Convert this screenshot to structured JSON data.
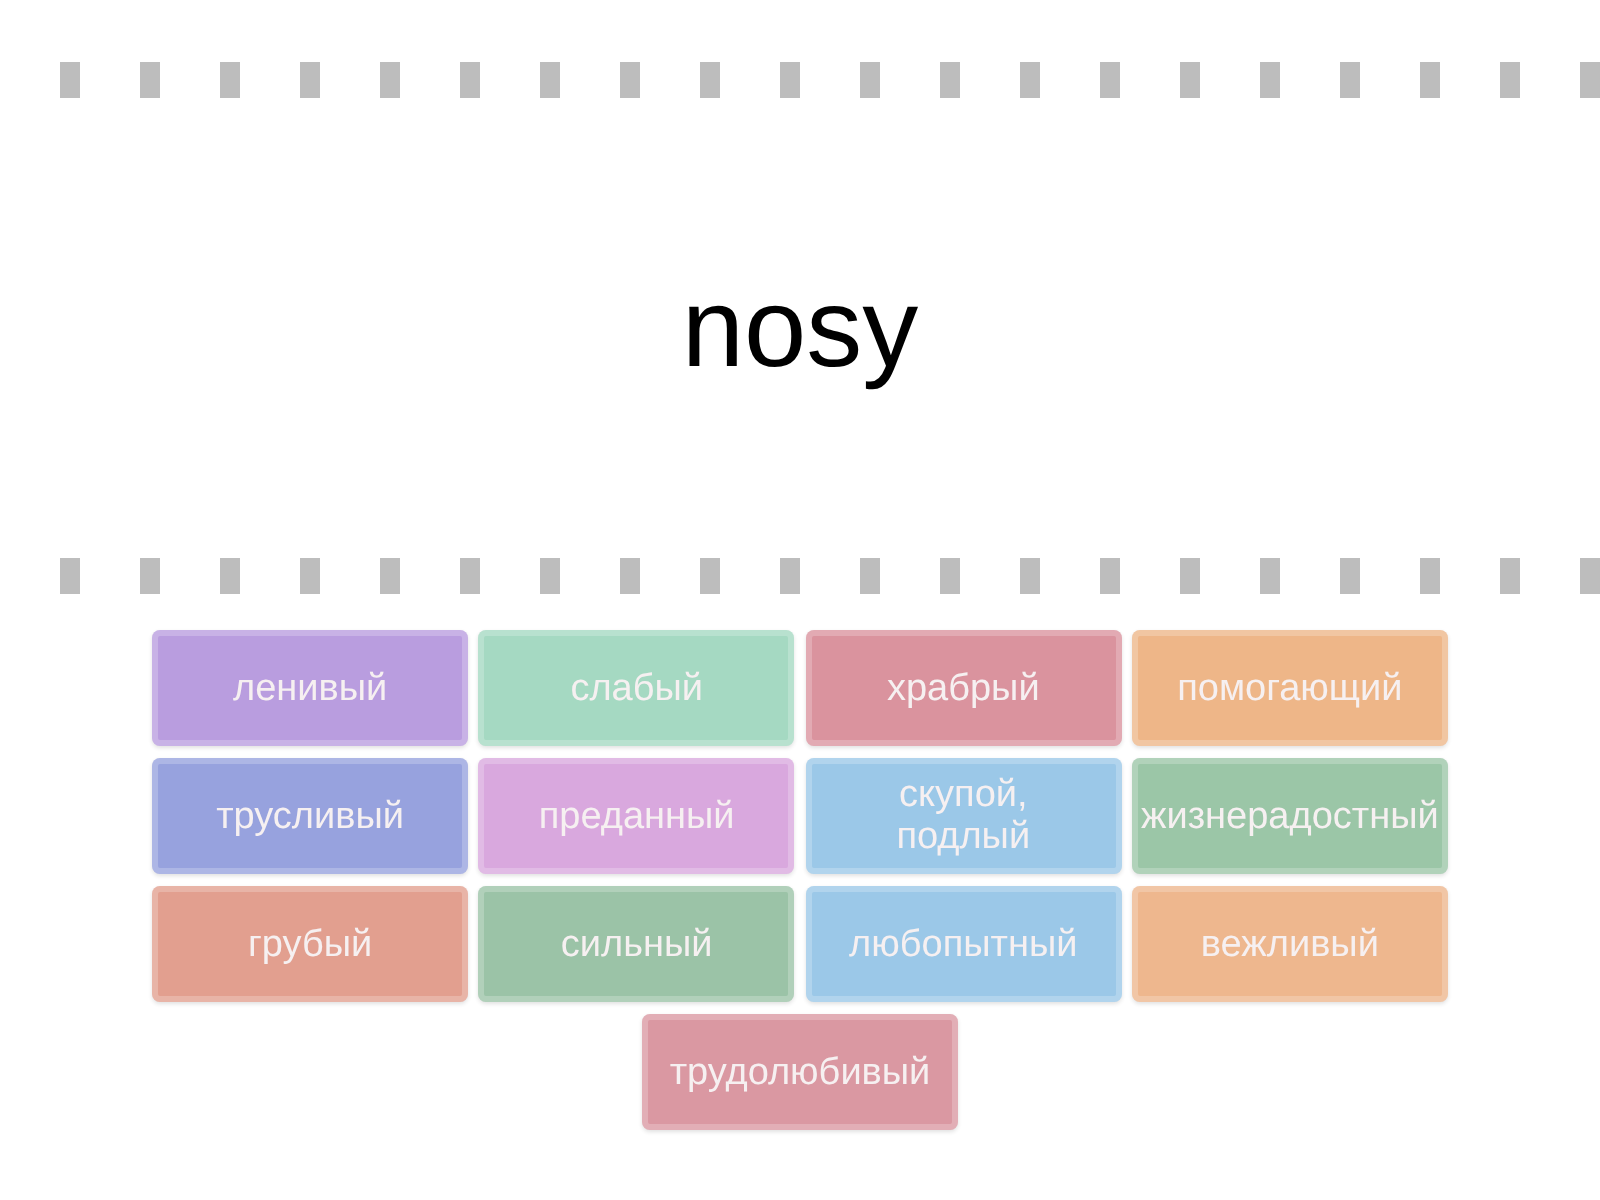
{
  "prompt": {
    "text": "nosy"
  },
  "tiles": [
    {
      "label": "ленивый",
      "color": "#b99ddf"
    },
    {
      "label": "слабый",
      "color": "#a5d9c2"
    },
    {
      "label": "храбрый",
      "color": "#da939e"
    },
    {
      "label": "помогающий",
      "color": "#eeb688"
    },
    {
      "label": "трусливый",
      "color": "#97a2de"
    },
    {
      "label": "преданный",
      "color": "#d9a8de"
    },
    {
      "label": "скупой, подлый",
      "color": "#9bc8e8"
    },
    {
      "label": "жизнерадостный",
      "color": "#9bc6a7"
    },
    {
      "label": "грубый",
      "color": "#e29f8f"
    },
    {
      "label": "сильный",
      "color": "#9bc3a7"
    },
    {
      "label": "любопытный",
      "color": "#9bc8e8"
    },
    {
      "label": "вежливый",
      "color": "#eeb78e"
    },
    {
      "label": "трудолюбивый",
      "color": "#da98a2"
    }
  ]
}
